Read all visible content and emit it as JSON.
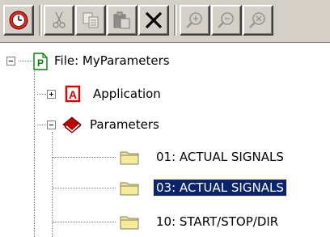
{
  "toolbar": {
    "buttons": [
      {
        "name": "clock-icon",
        "state": "enabled"
      },
      {
        "name": "cut-icon",
        "state": "disabled"
      },
      {
        "name": "copy-icon",
        "state": "disabled"
      },
      {
        "name": "paste-icon",
        "state": "disabled"
      },
      {
        "name": "delete-icon",
        "state": "enabled"
      },
      {
        "name": "zoom-in-icon",
        "state": "disabled"
      },
      {
        "name": "zoom-out-icon",
        "state": "disabled"
      },
      {
        "name": "zoom-reset-icon",
        "state": "disabled"
      }
    ]
  },
  "tree": {
    "root": {
      "label": "File: MyParameters",
      "icon": "parameter-file-icon",
      "expanded": true
    },
    "application": {
      "label": "Application",
      "icon": "application-icon",
      "expanded": false
    },
    "parameters": {
      "label": "Parameters",
      "icon": "book-icon",
      "expanded": true
    },
    "groups": [
      {
        "label": "01: ACTUAL SIGNALS",
        "icon": "folder-icon",
        "selected": false
      },
      {
        "label": "03: ACTUAL SIGNALS",
        "icon": "folder-icon",
        "selected": true
      },
      {
        "label": "10: START/STOP/DIR",
        "icon": "folder-icon",
        "selected": false
      }
    ]
  },
  "colors": {
    "selection": "#0a246a",
    "toolbar": "#d4d0c8",
    "folder": "#f0e68c",
    "app_red": "#e00000"
  }
}
